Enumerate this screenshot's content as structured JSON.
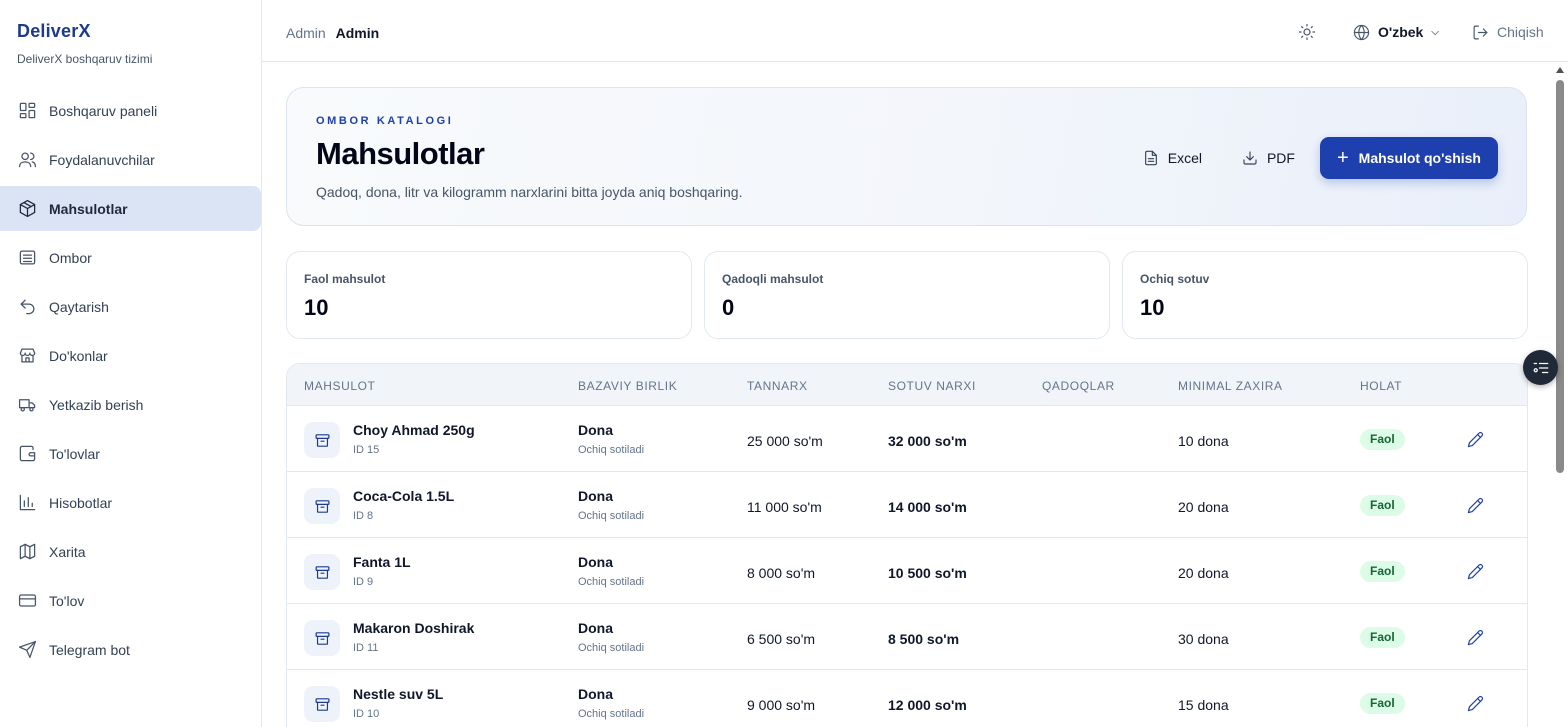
{
  "brand": {
    "name": "DeliverX",
    "subtitle": "DeliverX boshqaruv tizimi"
  },
  "sidebar": {
    "items": [
      {
        "label": "Boshqaruv paneli",
        "icon": "dashboard-icon"
      },
      {
        "label": "Foydalanuvchilar",
        "icon": "users-icon"
      },
      {
        "label": "Mahsulotlar",
        "icon": "box-icon",
        "active": true
      },
      {
        "label": "Ombor",
        "icon": "warehouse-icon"
      },
      {
        "label": "Qaytarish",
        "icon": "undo-icon"
      },
      {
        "label": "Do'konlar",
        "icon": "store-icon"
      },
      {
        "label": "Yetkazib berish",
        "icon": "truck-icon"
      },
      {
        "label": "To'lovlar",
        "icon": "wallet-icon"
      },
      {
        "label": "Hisobotlar",
        "icon": "bar-chart-icon"
      },
      {
        "label": "Xarita",
        "icon": "map-icon"
      },
      {
        "label": "To'lov",
        "icon": "credit-card-icon"
      },
      {
        "label": "Telegram bot",
        "icon": "send-icon"
      }
    ]
  },
  "header": {
    "breadcrumb_role": "Admin",
    "breadcrumb_user": "Admin",
    "language": "O'zbek",
    "logout": "Chiqish"
  },
  "hero": {
    "kicker": "OMBOR KATALOGI",
    "title": "Mahsulotlar",
    "description": "Qadoq, dona, litr va kilogramm narxlarini bitta joyda aniq boshqaring.",
    "excel_label": "Excel",
    "pdf_label": "PDF",
    "add_label": "Mahsulot qo'shish"
  },
  "stats": [
    {
      "label": "Faol mahsulot",
      "value": "10"
    },
    {
      "label": "Qadoqli mahsulot",
      "value": "0"
    },
    {
      "label": "Ochiq sotuv",
      "value": "10"
    }
  ],
  "table": {
    "columns": [
      "MAHSULOT",
      "BAZAVIY BIRLIK",
      "TANNARX",
      "SOTUV NARXI",
      "QADOQLAR",
      "MINIMAL ZAXIRA",
      "HOLAT"
    ],
    "rows": [
      {
        "name": "Choy Ahmad 250g",
        "id": "ID 15",
        "unit": "Dona",
        "unit_sub": "Ochiq sotiladi",
        "cost": "25 000 so'm",
        "price": "32 000 so'm",
        "packages": "",
        "min_stock": "10 dona",
        "status": "Faol"
      },
      {
        "name": "Coca-Cola 1.5L",
        "id": "ID 8",
        "unit": "Dona",
        "unit_sub": "Ochiq sotiladi",
        "cost": "11 000 so'm",
        "price": "14 000 so'm",
        "packages": "",
        "min_stock": "20 dona",
        "status": "Faol"
      },
      {
        "name": "Fanta 1L",
        "id": "ID 9",
        "unit": "Dona",
        "unit_sub": "Ochiq sotiladi",
        "cost": "8 000 so'm",
        "price": "10 500 so'm",
        "packages": "",
        "min_stock": "20 dona",
        "status": "Faol"
      },
      {
        "name": "Makaron Doshirak",
        "id": "ID 11",
        "unit": "Dona",
        "unit_sub": "Ochiq sotiladi",
        "cost": "6 500 so'm",
        "price": "8 500 so'm",
        "packages": "",
        "min_stock": "30 dona",
        "status": "Faol"
      },
      {
        "name": "Nestle suv 5L",
        "id": "ID 10",
        "unit": "Dona",
        "unit_sub": "Ochiq sotiladi",
        "cost": "9 000 so'm",
        "price": "12 000 so'm",
        "packages": "",
        "min_stock": "15 dona",
        "status": "Faol"
      }
    ]
  },
  "colors": {
    "accent": "#1e40af",
    "active_nav": "#dbe4f5",
    "status_bg": "#dcfce7",
    "status_text": "#166534"
  }
}
